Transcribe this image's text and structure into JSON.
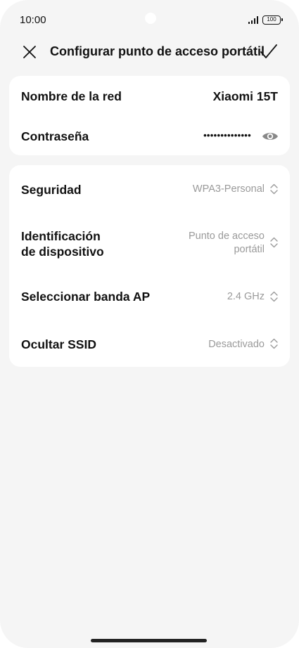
{
  "status_bar": {
    "time": "10:00",
    "battery": "100"
  },
  "header": {
    "title": "Configurar punto de acceso portátil",
    "close_icon": "close-icon",
    "confirm_icon": "checkmark-icon"
  },
  "network": {
    "name_label": "Nombre de la red",
    "name_value": "Xiaomi 15T",
    "password_label": "Contraseña",
    "password_value": "••••••••••••••",
    "password_icon": "eye-icon"
  },
  "settings": {
    "security_label": "Seguridad",
    "security_value": "WPA3-Personal",
    "device_id_label_line1": "Identificación",
    "device_id_label_line2": "de dispositivo",
    "device_id_value_line1": "Punto de acceso",
    "device_id_value_line2": "portátil",
    "band_label": "Seleccionar banda AP",
    "band_value": "2.4 GHz",
    "hide_ssid_label": "Ocultar SSID",
    "hide_ssid_value": "Desactivado"
  },
  "colors": {
    "background": "#f5f5f5",
    "card": "#ffffff",
    "text_primary": "#111111",
    "text_secondary": "#9a9a9a"
  }
}
